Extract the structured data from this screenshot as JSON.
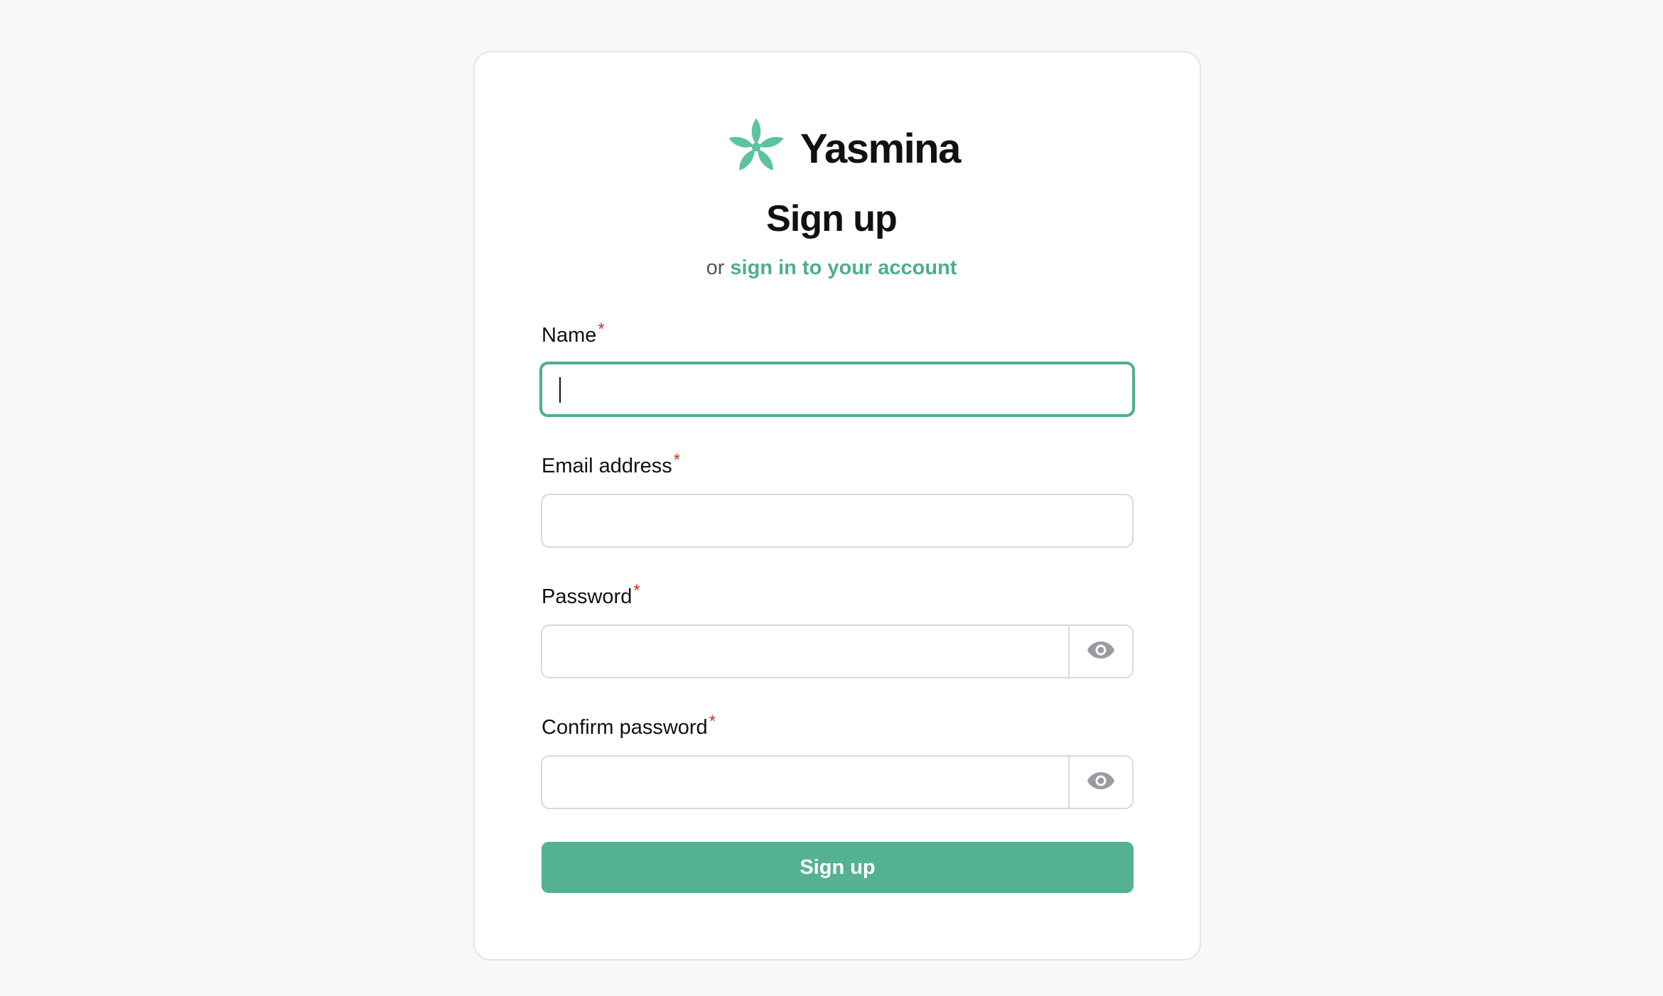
{
  "brand": {
    "name": "Yasmina",
    "logo_icon": "flower-icon",
    "accent_color": "#54b291"
  },
  "header": {
    "title": "Sign up",
    "subtitle_prefix": "or",
    "signin_link": "sign in to your account"
  },
  "form": {
    "required_marker": "*",
    "name": {
      "label": "Name",
      "value": ""
    },
    "email": {
      "label": "Email address",
      "value": ""
    },
    "password": {
      "label": "Password",
      "value": "",
      "toggle_icon": "eye-icon"
    },
    "confirm_password": {
      "label": "Confirm password",
      "value": "",
      "toggle_icon": "eye-icon"
    },
    "submit_label": "Sign up"
  }
}
